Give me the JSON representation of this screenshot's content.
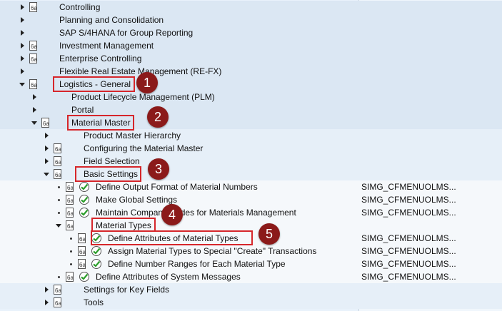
{
  "tree": {
    "rows": [
      {
        "label": "Controlling",
        "tech": ""
      },
      {
        "label": "Planning and Consolidation",
        "tech": ""
      },
      {
        "label": "SAP S/4HANA for Group Reporting",
        "tech": ""
      },
      {
        "label": "Investment Management",
        "tech": ""
      },
      {
        "label": "Enterprise Controlling",
        "tech": ""
      },
      {
        "label": "Flexible Real Estate Management (RE-FX)",
        "tech": ""
      },
      {
        "label": "Logistics - General",
        "tech": ""
      },
      {
        "label": "Product Lifecycle Management (PLM)",
        "tech": ""
      },
      {
        "label": "Portal",
        "tech": ""
      },
      {
        "label": "Material Master",
        "tech": ""
      },
      {
        "label": "Product Master Hierarchy",
        "tech": ""
      },
      {
        "label": "Configuring the Material Master",
        "tech": ""
      },
      {
        "label": "Field Selection",
        "tech": ""
      },
      {
        "label": "Basic Settings",
        "tech": ""
      },
      {
        "label": "Define Output Format of Material Numbers",
        "tech": "SIMG_CFMENUOLMS..."
      },
      {
        "label": "Make Global Settings",
        "tech": "SIMG_CFMENUOLMS..."
      },
      {
        "label": "Maintain Company Codes for Materials Management",
        "tech": "SIMG_CFMENUOLMS..."
      },
      {
        "label": "Material Types",
        "tech": ""
      },
      {
        "label": "Define Attributes of Material Types",
        "tech": "SIMG_CFMENUOLMS..."
      },
      {
        "label": "Assign Material Types to Special \"Create\" Transactions",
        "tech": "SIMG_CFMENUOLMS..."
      },
      {
        "label": "Define Number Ranges for Each Material Type",
        "tech": "SIMG_CFMENUOLMS..."
      },
      {
        "label": "Define Attributes of System Messages",
        "tech": "SIMG_CFMENUOLMS..."
      },
      {
        "label": "Settings for Key Fields",
        "tech": ""
      },
      {
        "label": "Tools",
        "tech": ""
      }
    ]
  },
  "annotations": {
    "badges": [
      "1",
      "2",
      "3",
      "4",
      "5"
    ],
    "highlight_color": "#d6262b",
    "badge_color": "#8b1a1a"
  }
}
